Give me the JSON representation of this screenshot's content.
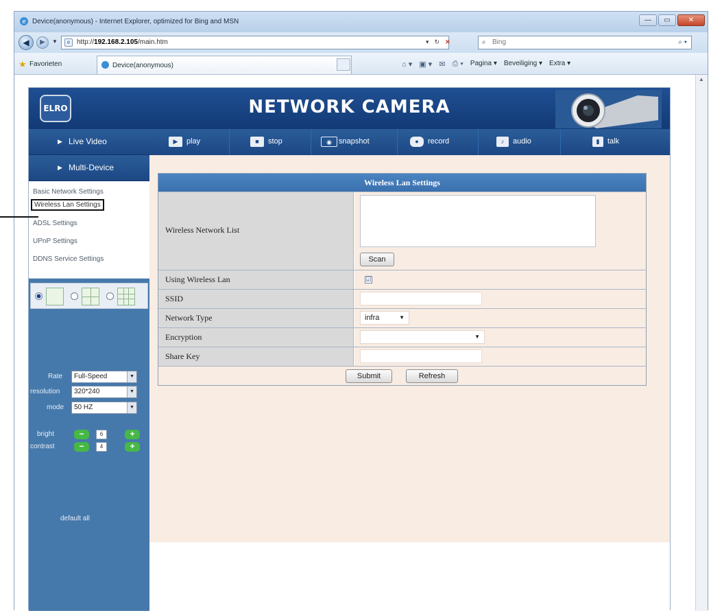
{
  "browser": {
    "window_title": "Device(anonymous) - Internet Explorer, optimized for Bing and MSN",
    "url_prefix": "http://",
    "url_host": "192.168.2.105",
    "url_path": "/main.htm",
    "search_placeholder": "Bing",
    "favorites_label": "Favorieten",
    "tab_title": "Device(anonymous)",
    "cmd_pagina": "Pagina ▾",
    "cmd_beveiliging": "Beveiliging ▾",
    "cmd_extra": "Extra ▾"
  },
  "app": {
    "logo_text": "ELRO",
    "title": "NETWORK CAMERA"
  },
  "sidebar": {
    "live_video": "Live Video",
    "multi_device": "Multi-Device",
    "menu": [
      {
        "label": "Basic Network Settings"
      },
      {
        "label": "Wireless Lan Settings"
      },
      {
        "label": "ADSL Settings"
      },
      {
        "label": "UPnP Settings"
      },
      {
        "label": "DDNS Service Settings"
      }
    ],
    "rate_label": "Rate",
    "rate_value": "Full-Speed",
    "resolution_label": "resolution",
    "resolution_value": "320*240",
    "mode_label": "mode",
    "mode_value": "50 HZ",
    "bright_label": "bright",
    "bright_value": "6",
    "contrast_label": "contrast",
    "contrast_value": "4",
    "plus": "+",
    "minus": "−",
    "default_all": "default all"
  },
  "toolbar": {
    "play": "play",
    "stop": "stop",
    "snapshot": "snapshot",
    "record": "record",
    "audio": "audio",
    "talk": "talk"
  },
  "form": {
    "title": "Wireless Lan Settings",
    "network_list_label": "Wireless Network List",
    "scan": "Scan",
    "using_wireless_label": "Using Wireless Lan",
    "using_wireless_checked": "☑",
    "ssid_label": "SSID",
    "ssid_value": "",
    "network_type_label": "Network Type",
    "network_type_value": "infra",
    "encryption_label": "Encryption",
    "encryption_value": "",
    "share_key_label": "Share Key",
    "share_key_value": "",
    "submit": "Submit",
    "refresh": "Refresh"
  }
}
